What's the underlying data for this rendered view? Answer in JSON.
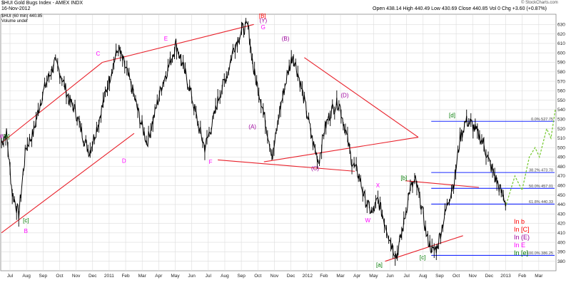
{
  "header": {
    "symbol": "$HUI",
    "name": "Gold Bugs Index - AMEX",
    "exchange": "INDX",
    "date": "16-Nov-2012",
    "interval": "(60 min)",
    "last": "440.85",
    "volume_note": "Volume undef",
    "quote": "Open 438.14  High 440.49  Low 430.69  Close 440.85  Vol 0  Chg +3.60 (+0.87%)",
    "watermark": "© StockCharts.com"
  },
  "chart_data": {
    "type": "line",
    "title": "$HUI Gold Bugs Index - AMEX",
    "x_ticks": [
      "Jul",
      "Aug",
      "Sep",
      "Oct",
      "Nov",
      "Dec",
      "2011",
      "Feb",
      "Mar",
      "Apr",
      "May",
      "Jun",
      "Jul",
      "Aug",
      "Sep",
      "Oct",
      "Nov",
      "Dec",
      "2012",
      "Feb",
      "Mar",
      "Apr",
      "May",
      "Jun",
      "Jul",
      "Aug",
      "Sep",
      "Oct",
      "Nov",
      "Dec",
      "2013",
      "Feb",
      "Mar"
    ],
    "ylim": [
      370,
      640
    ],
    "y_ticks": [
      380,
      390,
      400,
      410,
      420,
      430,
      440,
      450,
      460,
      470,
      480,
      490,
      500,
      510,
      520,
      530,
      540,
      550,
      560,
      570,
      580,
      590,
      600,
      610,
      620,
      630
    ],
    "grid": true,
    "series": [
      {
        "values": [
          [
            0.0,
            505
          ],
          [
            3.5,
            515
          ],
          [
            7.5,
            452
          ],
          [
            12.0,
            430
          ],
          [
            17.0,
            500
          ],
          [
            22.0,
            515
          ],
          [
            27.0,
            548
          ],
          [
            31.0,
            568
          ],
          [
            37.0,
            590
          ],
          [
            41.0,
            578
          ],
          [
            47.0,
            550
          ],
          [
            51.0,
            540
          ],
          [
            57.0,
            510
          ],
          [
            61.0,
            495
          ],
          [
            67.0,
            525
          ],
          [
            71.0,
            550
          ],
          [
            77.0,
            585
          ],
          [
            81.0,
            605
          ],
          [
            87.0,
            580
          ],
          [
            91.0,
            560
          ],
          [
            97.0,
            525
          ],
          [
            101.0,
            505
          ],
          [
            107.0,
            540
          ],
          [
            111.0,
            565
          ],
          [
            117.0,
            590
          ],
          [
            121.0,
            610
          ],
          [
            127.0,
            580
          ],
          [
            131.0,
            560
          ],
          [
            137.0,
            520
          ],
          [
            141.0,
            500
          ],
          [
            147.0,
            530
          ],
          [
            151.0,
            555
          ],
          [
            157.0,
            580
          ],
          [
            161.0,
            605
          ],
          [
            167.0,
            625
          ],
          [
            171.0,
            628
          ],
          [
            175.0,
            580
          ],
          [
            180.0,
            550
          ],
          [
            184.0,
            520
          ],
          [
            188.0,
            490
          ],
          [
            193.0,
            540
          ],
          [
            198.0,
            575
          ],
          [
            202.0,
            598
          ],
          [
            207.0,
            570
          ],
          [
            212.0,
            535
          ],
          [
            216.0,
            505
          ],
          [
            220.0,
            485
          ],
          [
            224.0,
            520
          ],
          [
            229.0,
            540
          ],
          [
            234.0,
            548
          ],
          [
            239.0,
            515
          ],
          [
            243.0,
            485
          ],
          [
            248.0,
            470
          ],
          [
            252.0,
            445
          ],
          [
            257.0,
            430
          ],
          [
            261.0,
            445
          ],
          [
            266.0,
            420
          ],
          [
            270.0,
            400
          ],
          [
            274.0,
            385
          ],
          [
            279.0,
            420
          ],
          [
            283.0,
            455
          ],
          [
            287.0,
            465
          ],
          [
            291.0,
            440
          ],
          [
            295.0,
            405
          ],
          [
            299.0,
            390
          ],
          [
            302.0,
            395
          ],
          [
            306.0,
            420
          ],
          [
            310.0,
            445
          ],
          [
            314.0,
            465
          ],
          [
            318.0,
            510
          ],
          [
            322.0,
            528
          ],
          [
            326.0,
            525
          ],
          [
            330.0,
            515
          ],
          [
            334.0,
            505
          ],
          [
            338.0,
            485
          ],
          [
            342.0,
            470
          ],
          [
            346.0,
            455
          ],
          [
            350.0,
            440.85
          ]
        ]
      }
    ],
    "x_range": [
      0,
      384
    ],
    "projection": [
      [
        350,
        440
      ],
      [
        356,
        470
      ],
      [
        361,
        455
      ],
      [
        366,
        490
      ],
      [
        370,
        500
      ],
      [
        373,
        490
      ],
      [
        378,
        520
      ],
      [
        381,
        510
      ],
      [
        384,
        540
      ]
    ],
    "fib_levels": [
      {
        "label": "0.0% 527.75",
        "value": 527.75
      },
      {
        "label": "38.2% 473.70",
        "value": 473.7
      },
      {
        "label": "50.0% 457.01",
        "value": 457.01
      },
      {
        "label": "61.8% 440.33",
        "value": 440.33
      },
      {
        "label": "100.0% 386.25",
        "value": 386.25
      }
    ],
    "trendlines": [
      [
        [
          0,
          505
        ],
        [
          70,
          590
        ]
      ],
      [
        [
          0,
          410
        ],
        [
          92,
          515
        ]
      ],
      [
        [
          70,
          590
        ],
        [
          175,
          630
        ]
      ],
      [
        [
          150,
          487
        ],
        [
          245,
          475
        ]
      ],
      [
        [
          210,
          595
        ],
        [
          289,
          511
        ]
      ],
      [
        [
          182,
          485
        ],
        [
          289,
          511
        ]
      ],
      [
        [
          280,
          465
        ],
        [
          331,
          458
        ]
      ],
      [
        [
          266,
          380
        ],
        [
          320,
          407
        ]
      ]
    ],
    "wave_labels": [
      {
        "text": "W",
        "x": 0.5,
        "y": 510,
        "color": "#9b009b"
      },
      {
        "text": "[b]",
        "x": 3.5,
        "y": 510,
        "color": "#007a00"
      },
      {
        "text": "[c]",
        "x": 17.0,
        "y": 421,
        "color": "#007a00"
      },
      {
        "text": "B",
        "x": 17.0,
        "y": 410,
        "color": "#ff00ff"
      },
      {
        "text": "C",
        "x": 67.0,
        "y": 597,
        "color": "#ff00ff"
      },
      {
        "text": "D",
        "x": 85.0,
        "y": 484,
        "color": "#ff00ff"
      },
      {
        "text": "E",
        "x": 114.0,
        "y": 613,
        "color": "#ff00ff"
      },
      {
        "text": "F",
        "x": 145.0,
        "y": 483,
        "color": "#ff00ff"
      },
      {
        "text": "[B]",
        "x": 181.0,
        "y": 637,
        "color": "#ff0000"
      },
      {
        "text": "(Y)",
        "x": 181.5,
        "y": 632,
        "color": "#9b009b"
      },
      {
        "text": "G",
        "x": 181.5,
        "y": 625,
        "color": "#ff00ff"
      },
      {
        "text": "(B)",
        "x": 197.0,
        "y": 613,
        "color": "#9b009b"
      },
      {
        "text": "(A)",
        "x": 174.0,
        "y": 520,
        "color": "#9b009b"
      },
      {
        "text": "(C)",
        "x": 217.5,
        "y": 476,
        "color": "#9b009b"
      },
      {
        "text": "(D)",
        "x": 238.0,
        "y": 553,
        "color": "#9b009b"
      },
      {
        "text": "X",
        "x": 261.0,
        "y": 458,
        "color": "#ff00ff"
      },
      {
        "text": "W",
        "x": 254.0,
        "y": 421,
        "color": "#ff00ff"
      },
      {
        "text": "[b]",
        "x": 279.0,
        "y": 466,
        "color": "#007a00"
      },
      {
        "text": "[a]",
        "x": 262.0,
        "y": 374,
        "color": "#007a00"
      },
      {
        "text": "[c]",
        "x": 292.0,
        "y": 382,
        "color": "#007a00"
      },
      {
        "text": "[d]",
        "x": 312.5,
        "y": 532,
        "color": "#007a00"
      }
    ],
    "legend": [
      {
        "text": "In b",
        "color": "#ff0000"
      },
      {
        "text": "In [C]",
        "color": "#ff0000"
      },
      {
        "text": "In (E)",
        "color": "#9b009b"
      },
      {
        "text": "In E",
        "color": "#ff00ff"
      },
      {
        "text": "In [e]",
        "color": "#007a00"
      }
    ],
    "colors": {
      "price": "#000000",
      "trendline": "#e8202a",
      "fib": "#1a2aff",
      "projection": "#7ccc3a",
      "grid": "#dcdcdc"
    }
  }
}
